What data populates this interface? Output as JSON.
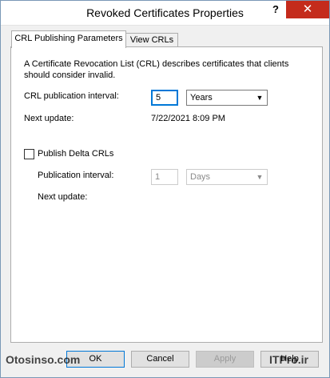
{
  "window": {
    "title": "Revoked Certificates Properties",
    "help_glyph": "?",
    "close_glyph": "✕"
  },
  "tabs": [
    {
      "label": "CRL Publishing Parameters",
      "active": true
    },
    {
      "label": "View CRLs",
      "active": false
    }
  ],
  "crl": {
    "description": "A Certificate Revocation List (CRL) describes certificates that clients should consider invalid.",
    "interval_label": "CRL publication interval:",
    "interval_value": "5",
    "interval_unit": "Years",
    "next_update_label": "Next update:",
    "next_update_value": "7/22/2021 8:09 PM"
  },
  "delta": {
    "checkbox_label": "Publish Delta CRLs",
    "checked": false,
    "interval_label": "Publication interval:",
    "interval_value": "1",
    "interval_unit": "Days",
    "next_update_label": "Next update:"
  },
  "buttons": {
    "ok": "OK",
    "cancel": "Cancel",
    "apply": "Apply",
    "help": "Help"
  },
  "watermarks": {
    "left": "Otosinso.com",
    "right": "ITPro.ir"
  }
}
